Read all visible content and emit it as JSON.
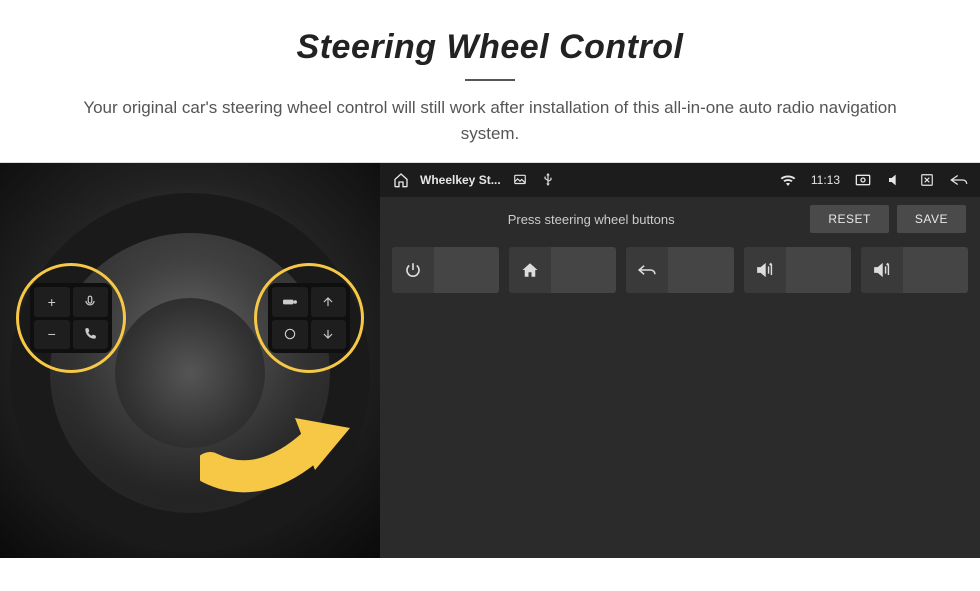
{
  "header": {
    "title": "Steering Wheel Control",
    "subtitle": "Your original car's steering wheel control will still work after installation of this all-in-one auto radio navigation system."
  },
  "statusbar": {
    "app_title": "Wheelkey St...",
    "time": "11:13",
    "icons": {
      "home": "home-icon",
      "picture": "picture-icon",
      "usb": "usb-icon",
      "wifi": "wifi-icon",
      "screenshot": "screenshot-icon",
      "mute": "mute-icon",
      "close": "close-icon",
      "back": "back-icon"
    }
  },
  "panel": {
    "instruction": "Press steering wheel buttons",
    "buttons": {
      "reset": "RESET",
      "save": "SAVE"
    },
    "slots": [
      {
        "icon": "power-icon"
      },
      {
        "icon": "home-icon"
      },
      {
        "icon": "undo-icon"
      },
      {
        "icon": "volume-up-icon"
      },
      {
        "icon": "volume-up-icon"
      }
    ]
  },
  "wheel_buttons": {
    "left": [
      "plus",
      "voice",
      "minus",
      "phone"
    ],
    "right": [
      "tank",
      "nav-up",
      "cycle",
      "nav-down"
    ]
  },
  "colors": {
    "highlight": "#f6c845",
    "panel_bg": "#2b2b2b",
    "status_bg": "#1c1c1c"
  }
}
